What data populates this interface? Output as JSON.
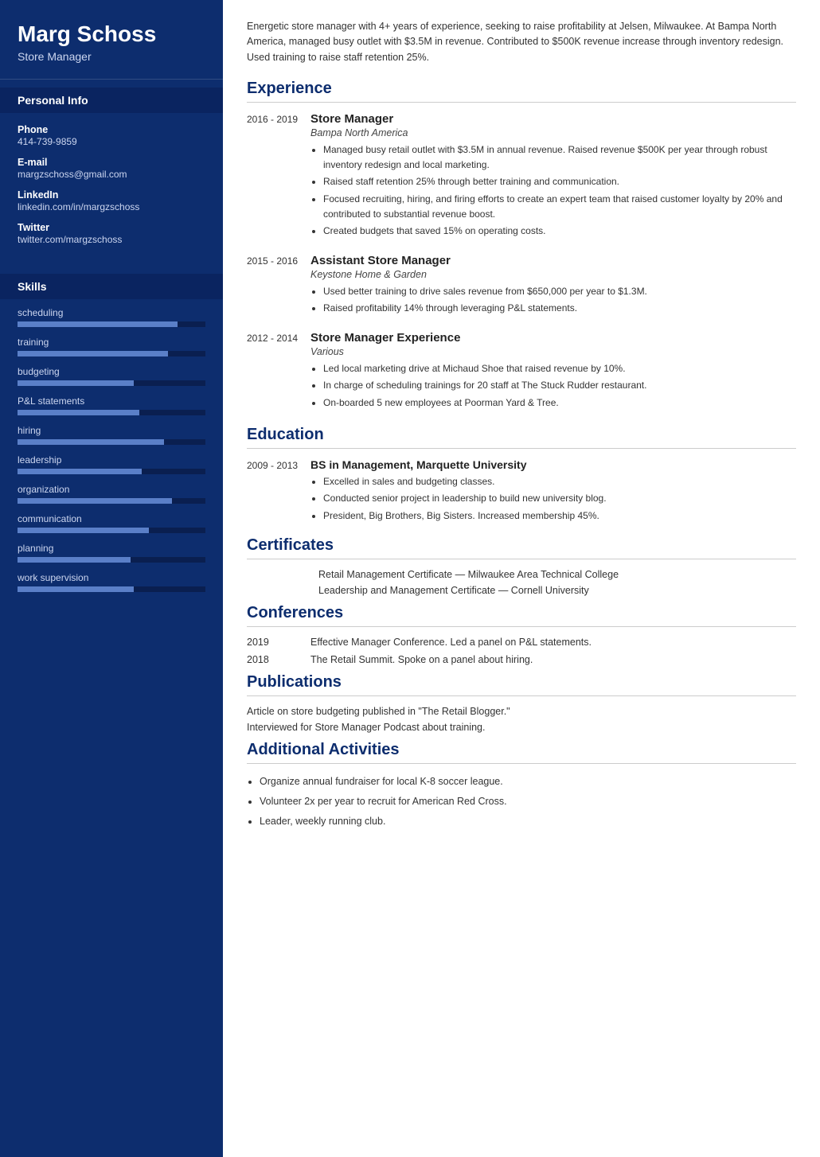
{
  "sidebar": {
    "name": "Marg Schoss",
    "title": "Store Manager",
    "personal_info_label": "Personal Info",
    "contact": {
      "phone_label": "Phone",
      "phone": "414-739-9859",
      "email_label": "E-mail",
      "email": "margzschoss@gmail.com",
      "linkedin_label": "LinkedIn",
      "linkedin": "linkedin.com/in/margzschoss",
      "twitter_label": "Twitter",
      "twitter": "twitter.com/margzschoss"
    },
    "skills_label": "Skills",
    "skills": [
      {
        "name": "scheduling",
        "fill": 85,
        "dark": 15
      },
      {
        "name": "training",
        "fill": 80,
        "dark": 20
      },
      {
        "name": "budgeting",
        "fill": 62,
        "dark": 38
      },
      {
        "name": "P&L statements",
        "fill": 65,
        "dark": 35
      },
      {
        "name": "hiring",
        "fill": 78,
        "dark": 22
      },
      {
        "name": "leadership",
        "fill": 66,
        "dark": 34
      },
      {
        "name": "organization",
        "fill": 82,
        "dark": 18
      },
      {
        "name": "communication",
        "fill": 70,
        "dark": 30
      },
      {
        "name": "planning",
        "fill": 60,
        "dark": 40
      },
      {
        "name": "work supervision",
        "fill": 62,
        "dark": 38
      }
    ]
  },
  "summary": "Energetic store manager with 4+ years of experience, seeking to raise profitability at Jelsen, Milwaukee. At Bampa North America, managed busy outlet with $3.5M in revenue. Contributed to $500K revenue increase through inventory redesign. Used training to raise staff retention 25%.",
  "experience": {
    "section_title": "Experience",
    "entries": [
      {
        "dates": "2016 - 2019",
        "title": "Store Manager",
        "company": "Bampa North America",
        "bullets": [
          "Managed busy retail outlet with $3.5M in annual revenue. Raised revenue $500K per year through robust inventory redesign and local marketing.",
          "Raised staff retention 25% through better training and communication.",
          "Focused recruiting, hiring, and firing efforts to create an expert team that raised customer loyalty by 20% and contributed to substantial revenue boost.",
          "Created budgets that saved 15% on operating costs."
        ]
      },
      {
        "dates": "2015 - 2016",
        "title": "Assistant Store Manager",
        "company": "Keystone Home & Garden",
        "bullets": [
          "Used better training to drive sales revenue from $650,000 per year to $1.3M.",
          "Raised profitability 14% through leveraging P&L statements."
        ]
      },
      {
        "dates": "2012 - 2014",
        "title": "Store Manager Experience",
        "company": "Various",
        "bullets": [
          "Led local marketing drive at Michaud Shoe that raised revenue by 10%.",
          "In charge of scheduling trainings for 20 staff at The Stuck Rudder restaurant.",
          "On-boarded 5 new employees at Poorman Yard & Tree."
        ]
      }
    ]
  },
  "education": {
    "section_title": "Education",
    "entries": [
      {
        "dates": "2009 - 2013",
        "degree": "BS in Management, Marquette University",
        "bullets": [
          "Excelled in sales and budgeting classes.",
          "Conducted senior project in leadership to build new university blog.",
          "President, Big Brothers, Big Sisters. Increased membership 45%."
        ]
      }
    ]
  },
  "certificates": {
    "section_title": "Certificates",
    "items": [
      "Retail Management Certificate — Milwaukee Area Technical College",
      "Leadership and Management Certificate — Cornell University"
    ]
  },
  "conferences": {
    "section_title": "Conferences",
    "items": [
      {
        "year": "2019",
        "text": "Effective Manager Conference. Led a panel on P&L statements."
      },
      {
        "year": "2018",
        "text": "The Retail Summit. Spoke on a panel about hiring."
      }
    ]
  },
  "publications": {
    "section_title": "Publications",
    "items": [
      "Article on store budgeting published in \"The Retail Blogger.\"",
      "Interviewed for Store Manager Podcast about training."
    ]
  },
  "activities": {
    "section_title": "Additional Activities",
    "bullets": [
      "Organize annual fundraiser for local K-8 soccer league.",
      "Volunteer 2x per year to recruit for American Red Cross.",
      "Leader, weekly running club."
    ]
  }
}
